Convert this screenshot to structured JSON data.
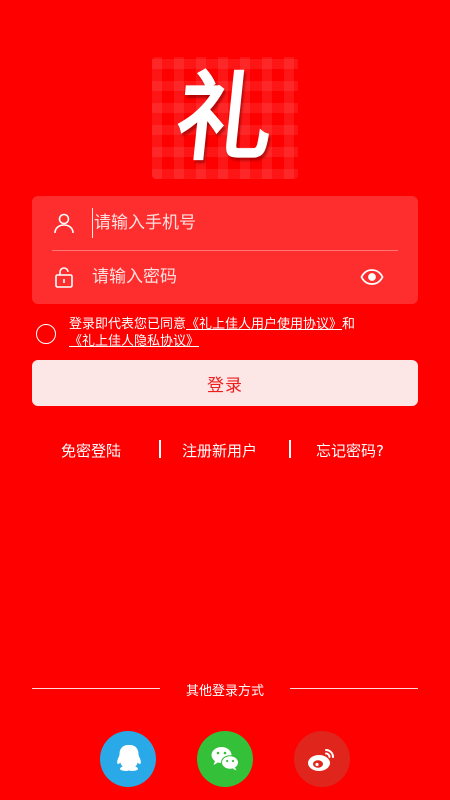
{
  "logo": {
    "char": "礼"
  },
  "form": {
    "phone_placeholder": "请输入手机号",
    "password_placeholder": "请输入密码"
  },
  "agreement": {
    "prefix": "登录即代表您已同意",
    "user_agreement": "《礼上佳人用户使用协议》",
    "conjunction": "和",
    "privacy_agreement": "《礼上佳人隐私协议》"
  },
  "login_button": "登录",
  "links": {
    "password_free": "免密登陆",
    "register": "注册新用户",
    "forgot": "忘记密码?"
  },
  "other_login": {
    "label": "其他登录方式",
    "providers": [
      "qq-icon",
      "wechat-icon",
      "weibo-icon"
    ]
  },
  "colors": {
    "background": "#fe0000",
    "button_bg": "#fde6e6",
    "button_text": "#ee1e1e",
    "qq": "#2aa9e8",
    "wechat": "#35c03a",
    "weibo": "#e0251d"
  }
}
